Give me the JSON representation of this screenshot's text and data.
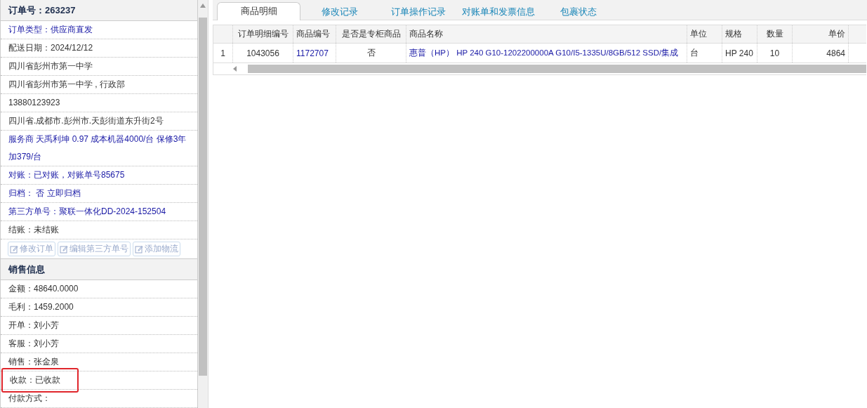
{
  "order_panel": {
    "title": "订单号：263237",
    "rows": [
      {
        "text": "订单类型：供应商直发",
        "kind": "link",
        "highlighted": false
      },
      {
        "text": "配送日期：2024/12/12",
        "kind": "plain",
        "highlighted": false
      },
      {
        "text": "四川省彭州市第一中学",
        "kind": "plain",
        "highlighted": false
      },
      {
        "text": "四川省彭州市第一中学 , 行政部",
        "kind": "plain",
        "highlighted": false
      },
      {
        "text": "13880123923",
        "kind": "plain",
        "highlighted": false
      },
      {
        "text": "四川省.成都市.彭州市.天彭街道东升街2号",
        "kind": "plain",
        "highlighted": false
      },
      {
        "text": "服务商 天禹利坤 0.97 成本机器4000/台 保修3年加379/台",
        "kind": "link",
        "highlighted": false
      },
      {
        "text": "对账：已对账，对账单号85675",
        "kind": "link",
        "highlighted": false
      },
      {
        "text": "归档： 否 立即归档",
        "kind": "link",
        "highlighted": false
      },
      {
        "text": "第三方单号：聚联一体化DD-2024-152504",
        "kind": "link",
        "highlighted": false
      },
      {
        "text": "结账：未结账",
        "kind": "plain",
        "highlighted": false
      }
    ],
    "buttons": [
      {
        "label": "修改订单",
        "disabled": true
      },
      {
        "label": "编辑第三方单号",
        "disabled": true
      },
      {
        "label": "添加物流",
        "disabled": true
      }
    ]
  },
  "sales_panel": {
    "title": "销售信息",
    "rows": [
      {
        "text": "金额：48640.0000",
        "highlighted": false
      },
      {
        "text": "毛利：1459.2000",
        "highlighted": false
      },
      {
        "text": "开单：刘小芳",
        "highlighted": false
      },
      {
        "text": "客服：刘小芳",
        "highlighted": false
      },
      {
        "text": "销售：张金泉",
        "highlighted": false
      },
      {
        "text": "收款：已收款",
        "highlighted": true
      },
      {
        "text": "付款方式：",
        "highlighted": false
      }
    ]
  },
  "tabs": [
    {
      "label": "商品明细",
      "selected": true
    },
    {
      "label": "修改记录",
      "selected": false
    },
    {
      "label": "订单操作记录",
      "selected": false
    },
    {
      "label": "对账单和发票信息",
      "selected": false
    },
    {
      "label": "包裹状态",
      "selected": false
    }
  ],
  "table": {
    "columns": [
      "订单明细编号",
      "商品编号",
      "是否是专柜商品",
      "商品名称",
      "单位",
      "规格",
      "数量",
      "单价"
    ],
    "rows": [
      {
        "index": "1",
        "cells": [
          {
            "text": "1043056",
            "kind": "plain"
          },
          {
            "text": "1172707",
            "kind": "link"
          },
          {
            "text": "否",
            "kind": "plain"
          },
          {
            "text": "惠普（HP） HP 240 G10-1202200000A G10/I5-1335U/8GB/512 SSD/集成",
            "kind": "link"
          },
          {
            "text": "台",
            "kind": "plain"
          },
          {
            "text": "HP 240",
            "kind": "plain"
          },
          {
            "text": "10",
            "kind": "plain"
          },
          {
            "text": "4864",
            "kind": "plain"
          }
        ]
      }
    ]
  }
}
